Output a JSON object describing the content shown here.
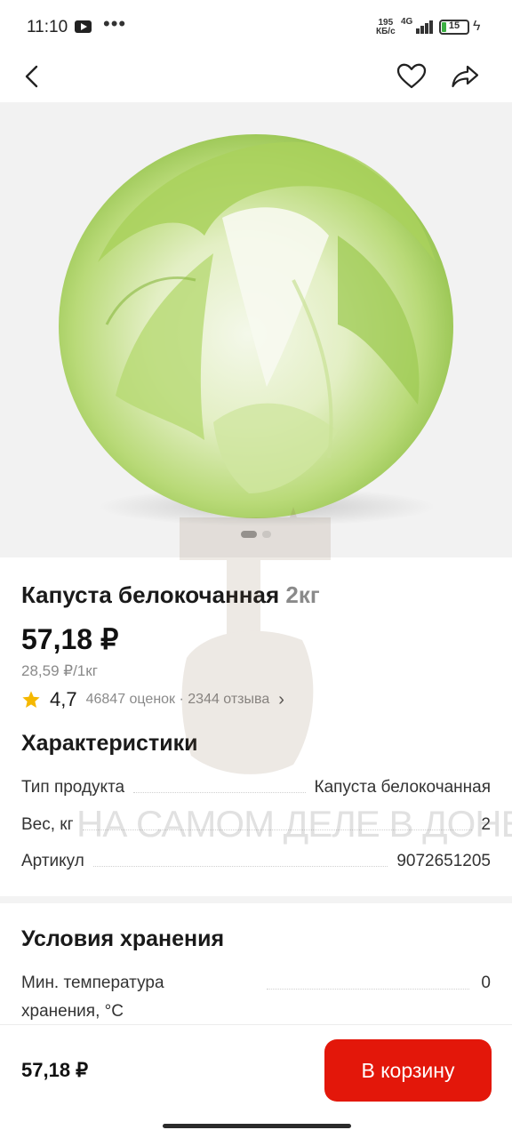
{
  "status_bar": {
    "time": "11:10",
    "dots": "•••",
    "speed_value": "195",
    "speed_unit": "КБ/с",
    "network": "4G",
    "battery": "15",
    "icons": [
      "youtube-icon",
      "signal-icon",
      "battery-icon",
      "charging-icon"
    ]
  },
  "toolbar": {
    "icons": [
      "back-arrow-icon",
      "heart-icon",
      "share-icon"
    ]
  },
  "gallery": {
    "image": "cabbage-photo",
    "page_count": 2,
    "active_page": 1
  },
  "product": {
    "name": "Капуста белокочанная",
    "weight": "2кг",
    "price": "57,18 ₽",
    "unit_price": "28,59 ₽/1кг",
    "rating": "4,7",
    "reviews": "46847 оценок · 2344 отзыва"
  },
  "characteristics": {
    "title": "Характеристики",
    "rows": [
      {
        "label": "Тип продукта",
        "value": "Капуста белокочанная"
      },
      {
        "label": "Вес, кг",
        "value": "2"
      },
      {
        "label": "Артикул",
        "value": "9072651205"
      }
    ]
  },
  "storage": {
    "title": "Условия хранения",
    "rows": [
      {
        "label": "Мин. температура хранения, °C",
        "value": "0"
      }
    ]
  },
  "bottom_bar": {
    "total": "57,18 ₽",
    "cart_label": "В корзину"
  },
  "watermark": {
    "text": "НА САМОМ ДЕЛЕ В ДОНЕЦКЕ"
  },
  "colors": {
    "accent": "#e3170a",
    "star": "#f5b800",
    "muted_text": "#8a8a8a"
  }
}
